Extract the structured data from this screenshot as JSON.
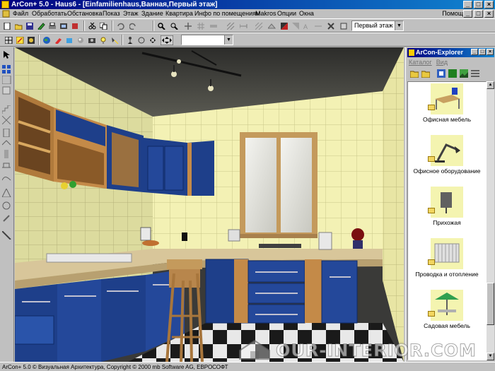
{
  "window": {
    "title": "ArCon+  5.0 - Haus6 - [Einfamilienhaus,Ванная,Первый этаж]",
    "controls": [
      "_",
      "□",
      "×"
    ]
  },
  "menu": {
    "items": [
      "Файл",
      "Обработать",
      "Обстановка",
      "Показ",
      "Этаж",
      "Здание",
      "Квартира",
      "Инфо по помещениям",
      "Makros",
      "Опции",
      "Окна"
    ],
    "help": "Помощь"
  },
  "toolbar": {
    "floor_select": "Первый этаж"
  },
  "explorer": {
    "title": "ArCon-Explorer",
    "menu": [
      "Каталог",
      "Вид"
    ],
    "items": [
      {
        "label": "Офисная мебель",
        "icon": "office-desk-thumb"
      },
      {
        "label": "Офисное оборудование",
        "icon": "desk-lamp-thumb"
      },
      {
        "label": "Прихожая",
        "icon": "hallway-thumb"
      },
      {
        "label": "Проводка и отопление",
        "icon": "radiator-thumb"
      },
      {
        "label": "Садовая мебель",
        "icon": "garden-umbrella-thumb"
      }
    ]
  },
  "status": {
    "text": "ArCon+ 5.0 © Визуальная Архитектура, Copyright © 2000 mb Software AG, ЕВРОСОФТ"
  },
  "watermark": {
    "text": "OUR-INTERIOR.COM"
  },
  "colors": {
    "title_active": "#000080",
    "cabinet_blue": "#1e3f8a",
    "tile": "#f3f1b4"
  }
}
